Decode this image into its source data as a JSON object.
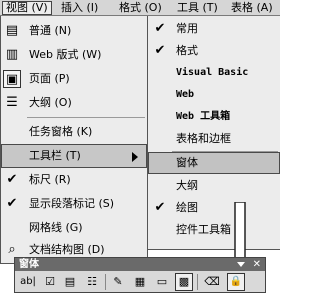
{
  "menubar": {
    "items": [
      {
        "label": "视图 (V)"
      },
      {
        "label": "插入 (I)"
      },
      {
        "label": "格式 (O)"
      },
      {
        "label": "工具 (T)"
      },
      {
        "label": "表格 (A)"
      }
    ]
  },
  "view_menu": {
    "items": [
      {
        "label": "普通 (N)",
        "icon": "normal-view-icon"
      },
      {
        "label": "Web 版式 (W)",
        "icon": "web-layout-icon"
      },
      {
        "label": "页面 (P)",
        "icon": "page-layout-icon"
      },
      {
        "label": "大纲 (O)",
        "icon": "outline-icon"
      },
      {
        "label": "任务窗格 (K)"
      },
      {
        "label": "工具栏 (T)",
        "has_submenu": true
      },
      {
        "label": "标尺 (R)",
        "checked": true
      },
      {
        "label": "显示段落标记 (S)",
        "checked": true
      },
      {
        "label": "网格线 (G)"
      },
      {
        "label": "文档结构图 (D)",
        "icon": "document-map-icon"
      }
    ]
  },
  "toolbars_submenu": {
    "items": [
      {
        "label": "常用",
        "checked": true
      },
      {
        "label": "格式",
        "checked": true
      },
      {
        "label": "Visual Basic"
      },
      {
        "label": "Web"
      },
      {
        "label": "Web 工具箱"
      },
      {
        "label": "表格和边框"
      },
      {
        "label": "窗体",
        "highlighted": true
      },
      {
        "label": "大纲"
      },
      {
        "label": "绘图",
        "checked": true
      },
      {
        "label": "控件工具箱"
      }
    ]
  },
  "form_toolbar": {
    "title": "窗体",
    "buttons": [
      {
        "icon": "text-form-field-icon",
        "glyph": "ab|"
      },
      {
        "icon": "checkbox-form-field-icon",
        "glyph": "☑"
      },
      {
        "icon": "dropdown-form-field-icon",
        "glyph": "▤"
      },
      {
        "icon": "form-field-options-icon",
        "glyph": "☷"
      },
      {
        "icon": "draw-table-icon",
        "glyph": "✎"
      },
      {
        "icon": "insert-table-icon",
        "glyph": "▦"
      },
      {
        "icon": "insert-frame-icon",
        "glyph": "▭"
      },
      {
        "icon": "form-field-shading-icon",
        "glyph": "▩"
      },
      {
        "icon": "reset-form-fields-icon",
        "glyph": "⌫"
      },
      {
        "icon": "protect-form-icon",
        "glyph": "🔒"
      }
    ]
  }
}
